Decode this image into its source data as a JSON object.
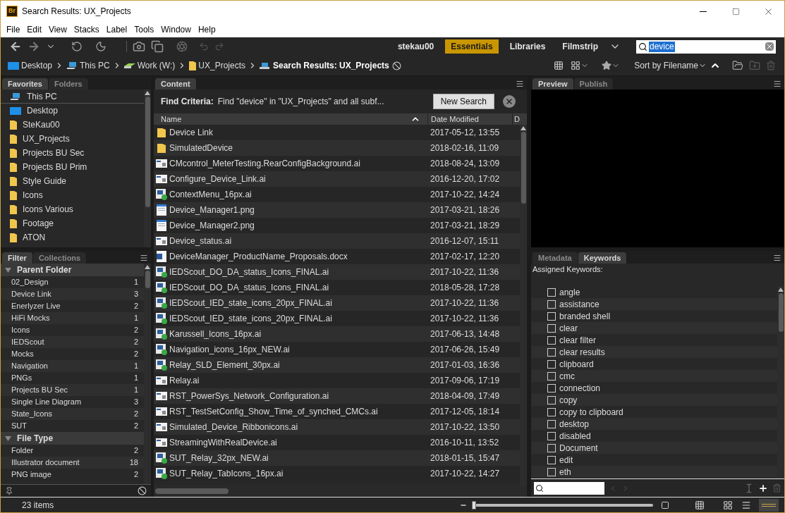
{
  "window": {
    "app_badge": "Br",
    "title": "Search Results: UX_Projects"
  },
  "menu": [
    "File",
    "Edit",
    "View",
    "Stacks",
    "Label",
    "Tools",
    "Window",
    "Help"
  ],
  "workspaces": [
    {
      "label": "stekau00",
      "selected": false
    },
    {
      "label": "Essentials",
      "selected": true
    },
    {
      "label": "Libraries",
      "selected": false
    },
    {
      "label": "Filmstrip",
      "selected": false
    }
  ],
  "search": {
    "value": "device"
  },
  "breadcrumbs": [
    {
      "label": "Desktop",
      "kind": "desktop",
      "current": false
    },
    {
      "label": "This PC",
      "kind": "pc",
      "current": false
    },
    {
      "label": "Work (W:)",
      "kind": "drive",
      "current": false
    },
    {
      "label": "UX_Projects",
      "kind": "folder",
      "current": false
    },
    {
      "label": "Search Results: UX_Projects",
      "kind": "search",
      "current": true
    }
  ],
  "sort": {
    "label": "Sort by Filename"
  },
  "favorites_panel": {
    "tabs": [
      {
        "label": "Favorites",
        "selected": true
      },
      {
        "label": "Folders",
        "selected": false
      }
    ],
    "items": [
      {
        "label": "This PC",
        "kind": "pc"
      },
      {
        "label": "Desktop",
        "kind": "desktop"
      },
      {
        "label": "SteKau00",
        "kind": "folder"
      },
      {
        "label": "UX_Projects",
        "kind": "folder"
      },
      {
        "label": "Projects BU Sec",
        "kind": "folder"
      },
      {
        "label": "Projects BU Prim",
        "kind": "folder"
      },
      {
        "label": "Style Guide",
        "kind": "folder"
      },
      {
        "label": "Icons",
        "kind": "folder"
      },
      {
        "label": "Icons Various",
        "kind": "folder"
      },
      {
        "label": "Footage",
        "kind": "folder"
      },
      {
        "label": "ATON",
        "kind": "folder"
      }
    ]
  },
  "filter_panel": {
    "tabs": [
      {
        "label": "Filter",
        "selected": true
      },
      {
        "label": "Collections",
        "selected": false
      }
    ],
    "groups": [
      {
        "title": "Parent Folder",
        "expanded": true,
        "items": [
          {
            "label": "02_Design",
            "count": "1"
          },
          {
            "label": "Device Link",
            "count": "3"
          },
          {
            "label": "Enerlyzer Live",
            "count": "2"
          },
          {
            "label": "HiFi Mocks",
            "count": "1"
          },
          {
            "label": "Icons",
            "count": "2"
          },
          {
            "label": "IEDScout",
            "count": "2"
          },
          {
            "label": "Mocks",
            "count": "2"
          },
          {
            "label": "Navigation",
            "count": "1"
          },
          {
            "label": "PNGs",
            "count": "1"
          },
          {
            "label": "Projects BU Sec",
            "count": "1"
          },
          {
            "label": "Single Line Diagram",
            "count": "3"
          },
          {
            "label": "State_Icons",
            "count": "2"
          },
          {
            "label": "SUT",
            "count": "2"
          }
        ]
      },
      {
        "title": "File Type",
        "expanded": true,
        "items": [
          {
            "label": "Folder",
            "count": "2"
          },
          {
            "label": "Illustrator document",
            "count": "18"
          },
          {
            "label": "PNG image",
            "count": "2"
          }
        ]
      }
    ]
  },
  "content_panel": {
    "tab": {
      "label": "Content",
      "selected": true
    },
    "find_label": "Find Criteria:",
    "find_text": "Find \"device\" in \"UX_Projects\" and all subf...",
    "new_search": "New Search",
    "columns": [
      "Name",
      "Date Modified",
      "D"
    ],
    "rows": [
      {
        "name": "Device Link",
        "date": "2017-05-12, 13:55",
        "kind": "folder"
      },
      {
        "name": "SimulatedDevice",
        "date": "2018-02-16, 11:09",
        "kind": "folder"
      },
      {
        "name": "CMcontrol_MeterTesting.RearConfigBackground.ai",
        "date": "2018-08-24, 13:09",
        "kind": "artwork"
      },
      {
        "name": "Configure_Device_Link.ai",
        "date": "2016-12-20, 17:02",
        "kind": "artwork"
      },
      {
        "name": "ContextMenu_16px.ai",
        "date": "2017-10-22, 14:24",
        "kind": "icon_sheet"
      },
      {
        "name": "Device_Manager1.png",
        "date": "2017-03-21, 18:26",
        "kind": "image"
      },
      {
        "name": "Device_Manager2.png",
        "date": "2017-03-21, 18:29",
        "kind": "image"
      },
      {
        "name": "Device_status.ai",
        "date": "2016-12-07, 15:11",
        "kind": "artwork"
      },
      {
        "name": "DeviceManager_ProductName_Proposals.docx",
        "date": "2017-02-17, 12:20",
        "kind": "word"
      },
      {
        "name": "IEDScout_DO_DA_status_Icons_FINAL.ai",
        "date": "2017-10-22, 11:36",
        "kind": "icon_sheet"
      },
      {
        "name": "IEDScout_DO_DA_status_Icons_FINAL.ai",
        "date": "2018-05-28, 17:28",
        "kind": "icon_sheet"
      },
      {
        "name": "IEDScout_IED_state_icons_20px_FINAL.ai",
        "date": "2017-10-22, 11:36",
        "kind": "icon_sheet"
      },
      {
        "name": "IEDScout_IED_state_icons_20px_FINAL.ai",
        "date": "2017-10-22, 11:36",
        "kind": "icon_sheet"
      },
      {
        "name": "Karussell_Icons_16px.ai",
        "date": "2017-06-13, 14:48",
        "kind": "icon_sheet"
      },
      {
        "name": "Navigation_icons_16px_NEW.ai",
        "date": "2017-06-26, 15:49",
        "kind": "icon_sheet"
      },
      {
        "name": "Relay_SLD_Element_30px.ai",
        "date": "2017-01-03, 16:36",
        "kind": "icon_sheet"
      },
      {
        "name": "Relay.ai",
        "date": "2017-09-06, 17:19",
        "kind": "artwork"
      },
      {
        "name": "RST_PowerSys_Network_Configuration.ai",
        "date": "2018-04-09, 17:49",
        "kind": "artwork"
      },
      {
        "name": "RST_TestSetConfig_Show_Time_of_synched_CMCs.ai",
        "date": "2017-12-05, 18:14",
        "kind": "artwork"
      },
      {
        "name": "Simulated_Device_Ribbonicons.ai",
        "date": "2017-10-22, 13:50",
        "kind": "artwork"
      },
      {
        "name": "StreamingWithRealDevice.ai",
        "date": "2016-10-11, 13:52",
        "kind": "artwork"
      },
      {
        "name": "SUT_Relay_32px_NEW.ai",
        "date": "2018-01-15, 15:47",
        "kind": "icon_sheet"
      },
      {
        "name": "SUT_Relay_TabIcons_16px.ai",
        "date": "2017-10-22, 14:27",
        "kind": "icon_sheet"
      }
    ]
  },
  "preview_panel": {
    "tabs": [
      {
        "label": "Preview",
        "selected": true
      },
      {
        "label": "Publish",
        "selected": false
      }
    ]
  },
  "keywords_panel": {
    "tabs": [
      {
        "label": "Metadata",
        "selected": false
      },
      {
        "label": "Keywords",
        "selected": true
      }
    ],
    "assigned_label": "Assigned Keywords:",
    "keywords": [
      {
        "label": "angle",
        "checked": false
      },
      {
        "label": "assistance",
        "checked": false
      },
      {
        "label": "branded shell",
        "checked": false
      },
      {
        "label": "clear",
        "checked": false
      },
      {
        "label": "clear filter",
        "checked": false
      },
      {
        "label": "clear results",
        "checked": false
      },
      {
        "label": "clipboard",
        "checked": false
      },
      {
        "label": "cmc",
        "checked": false
      },
      {
        "label": "connection",
        "checked": false
      },
      {
        "label": "copy",
        "checked": false
      },
      {
        "label": "copy to clipboard",
        "checked": false
      },
      {
        "label": "desktop",
        "checked": false
      },
      {
        "label": "disabled",
        "checked": false
      },
      {
        "label": "Document",
        "checked": false
      },
      {
        "label": "edit",
        "checked": false
      },
      {
        "label": "eth",
        "checked": false
      }
    ]
  },
  "status_bar": {
    "items": "23 items",
    "thumb_size": {
      "level": 0
    }
  }
}
